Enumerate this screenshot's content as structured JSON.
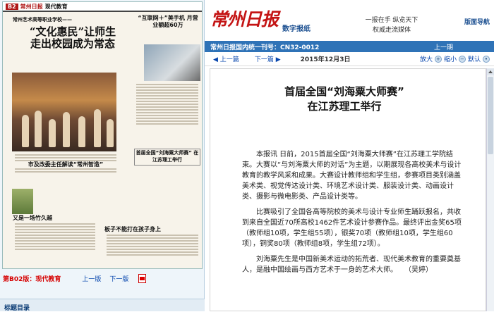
{
  "paper": {
    "page_no": "B2",
    "masthead": "常州日报",
    "section": "现代教育",
    "kicker": "常州艺术高等职业学校——",
    "headline1": "“文化惠民”让师生",
    "headline2": "走出校园成为常态",
    "sub_head": "“互联网＋”美手机 月营业额超60万",
    "mid_head": "市及改委主任解读“常州智造”",
    "small_head": "首届全国“刘海粟大师赛” 在江苏理工举行",
    "left_small": "又是一场竹久越",
    "right_small": "板子不能打在孩子身上"
  },
  "left_nav": {
    "edition": "第B02版：现代教育",
    "prev": "上一版",
    "next": "下一版"
  },
  "toc": "标题目录",
  "header": {
    "logo": "常州日报",
    "subtitle": "数字报纸",
    "slogan1": "一报在手 纵览天下",
    "slogan2": "权威走流媒体",
    "home": "版面导航"
  },
  "bluebar": {
    "title": "常州日报国内统一刊号：CN32-0012",
    "prev": "上一期"
  },
  "navbar": {
    "prev": "上一篇",
    "next": "下一篇",
    "date": "2015年12月3日",
    "zoom_in": "放大",
    "zoom_out": "缩小",
    "default": "默认"
  },
  "article": {
    "title1": "首届全国“刘海粟大师赛”",
    "title2": "在江苏理工举行",
    "p1": "本报讯 日前，2015首届全国“刘海粟大师赛”在江苏理工学院结束。大赛以“与刘海粟大师的对话”为主题，以期展现各高校美术与设计教育的教学风采和成果。大赛设计教师组和学生组，参赛项目类别涵盖美术类、视觉传达设计类、环境艺术设计类、服装设计类、动画设计类、摄影与微电影类、产品设计类等。",
    "p2": "比赛吸引了全国各高等院校的美术与设计专业师生踊跃报名，共收到来自全国近70所高校1462件艺术设计参赛作品。最终评出金奖65项（教师组10项，学生组55项），银奖70项（教师组10项，学生组60项），铜奖80项（教师组8项，学生组72项）。",
    "p3": "刘海粟先生是中国新美术运动的拓荒者、现代美术教育的重要奠基人，是融中国绘画与西方艺术于一身的艺术大师。　　（吴婷）"
  }
}
